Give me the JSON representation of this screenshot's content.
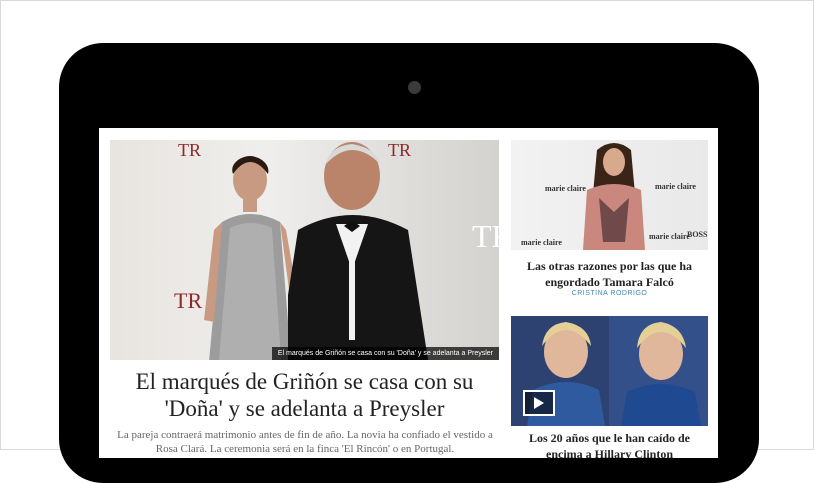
{
  "main_story": {
    "photo_caption": "El marqués de Griñón se casa con su 'Doña' y se adelanta a Preysler",
    "headline": "El marqués de Griñón se casa con su 'Doña' y se adelanta a Preysler",
    "summary": "La pareja contraerá matrimonio antes de fin de año. La novia ha confiado el vestido a Rosa Clará. La ceremonia será en la finca 'El Rincón' o en Portugal."
  },
  "side_stories": [
    {
      "headline": "Las otras razones por las que ha engordado Tamara Falcó",
      "author": "CRISTINA RODRIGO"
    },
    {
      "headline": "Los 20 años que le han caído de encima a Hillary Clinton"
    }
  ],
  "icons": {
    "video": "play-icon",
    "camera": "camera-icon"
  }
}
